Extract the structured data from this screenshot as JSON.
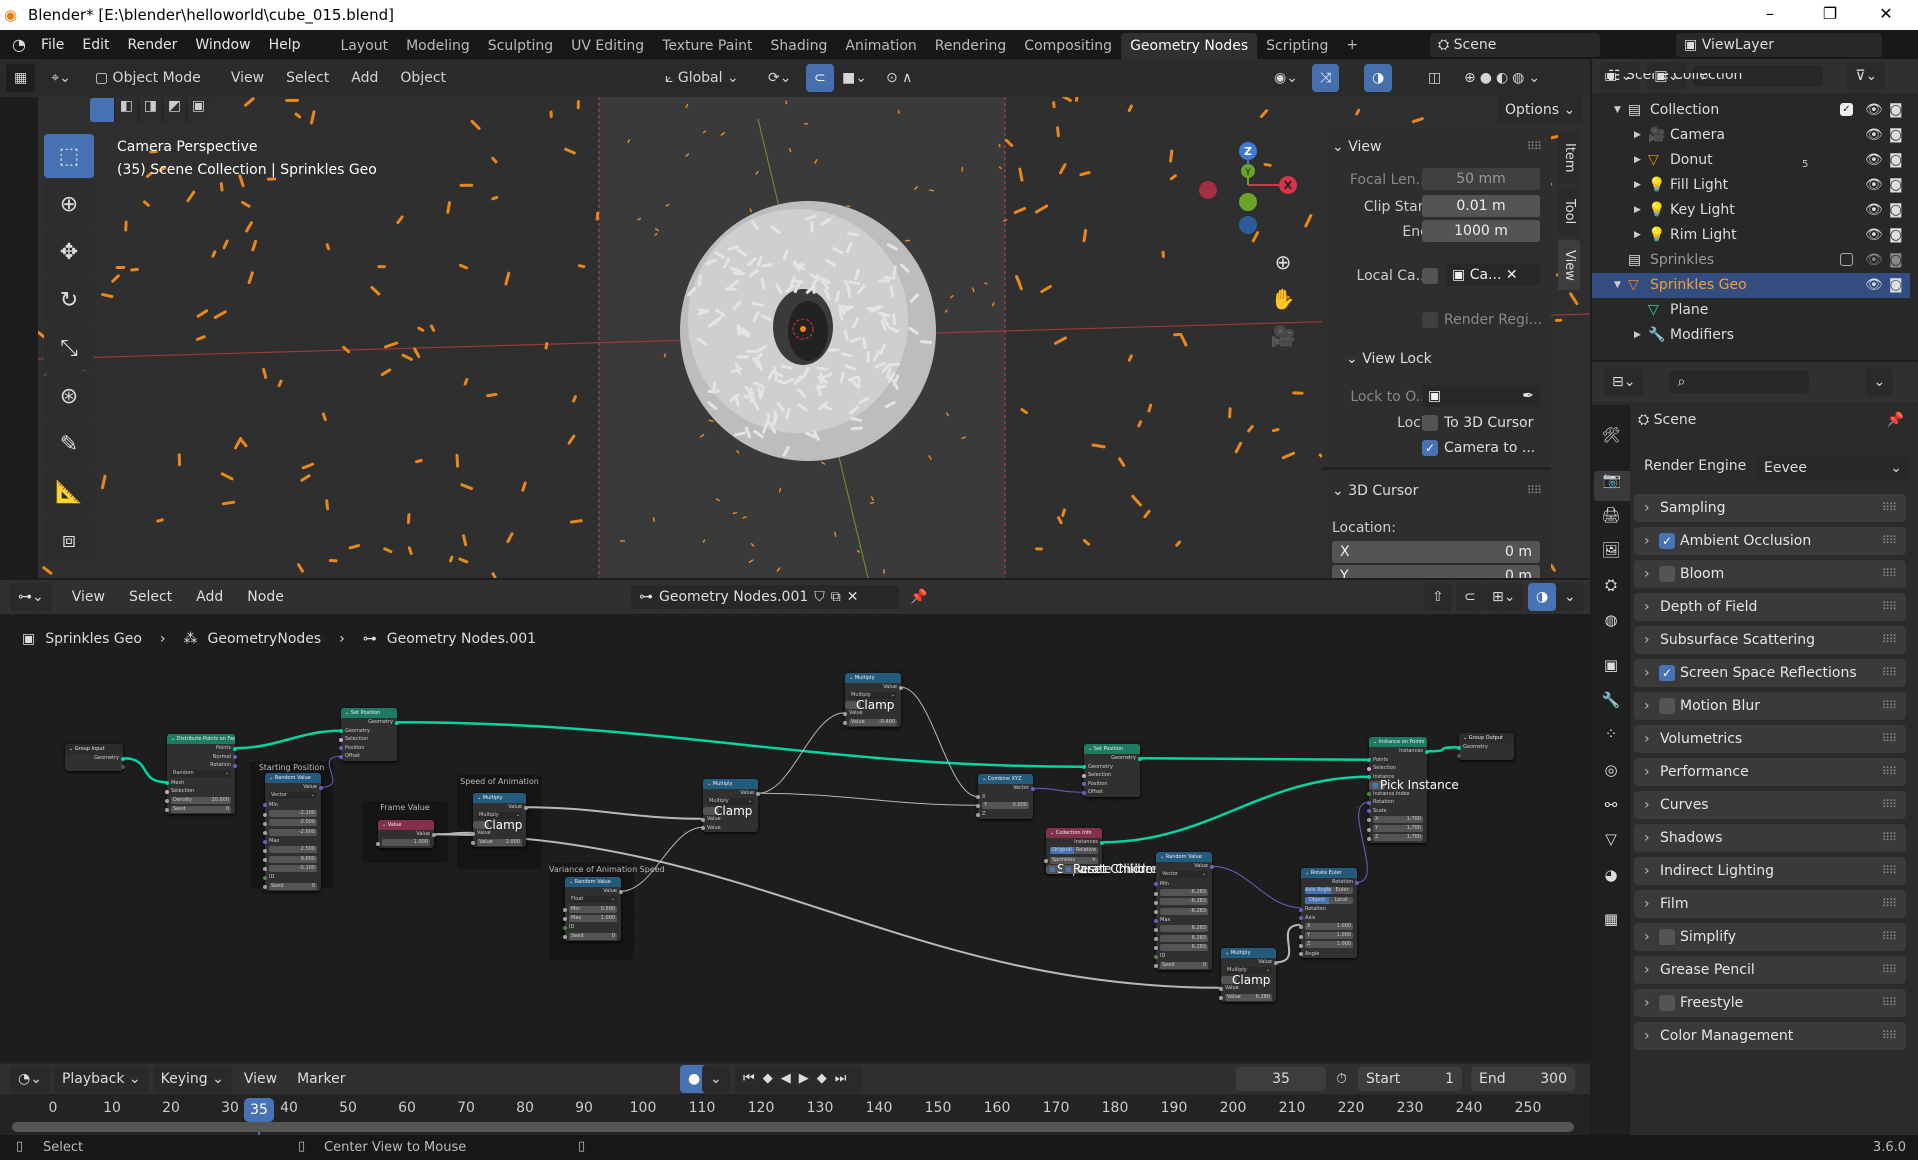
{
  "window": {
    "title": "Blender* [E:\\blender\\helloworld\\cube_015.blend]",
    "minimize": "–",
    "maximize": "❐",
    "close": "✕"
  },
  "menu": [
    "File",
    "Edit",
    "Render",
    "Window",
    "Help"
  ],
  "workspaces": [
    "Layout",
    "Modeling",
    "Sculpting",
    "UV Editing",
    "Texture Paint",
    "Shading",
    "Animation",
    "Rendering",
    "Compositing",
    "Geometry Nodes",
    "Scripting"
  ],
  "active_workspace": "Geometry Nodes",
  "add_workspace": "+",
  "scene": {
    "name": "Scene",
    "view_layer": "ViewLayer"
  },
  "viewport": {
    "mode": "Object Mode",
    "menus": [
      "View",
      "Select",
      "Add",
      "Object"
    ],
    "transform_orientation": "Global",
    "options": "Options",
    "info_title": "Camera Perspective",
    "info_sub": "(35) Scene Collection | Sprinkles Geo",
    "gizmo": {
      "z": "Z",
      "x": "X",
      "y": "Y"
    },
    "accent": "#4772b3",
    "sprinkle_color": "#e8871e"
  },
  "npanel": {
    "tabs": [
      "Item",
      "Tool",
      "View"
    ],
    "view": {
      "title": "View",
      "focal_label": "Focal Len...",
      "focal": "50 mm",
      "clip_start_label": "Clip Start",
      "clip_start": "0.01 m",
      "end_label": "End",
      "clip_end": "1000 m",
      "local_cam_label": "Local Ca...",
      "local_cam": "Ca...",
      "render_region": "Render Regi..."
    },
    "view_lock": {
      "title": "View Lock",
      "lock_obj_label": "Lock to O...",
      "lock_label": "Lock",
      "to_cursor": "To 3D Cursor",
      "camera_to": "Camera to ...",
      "camera_to_checked": true,
      "to_cursor_checked": false
    },
    "cursor": {
      "title": "3D Cursor",
      "location_label": "Location:",
      "x_label": "X",
      "x": "0 m",
      "y_label": "Y",
      "y": "0 m"
    }
  },
  "outliner": {
    "rows": [
      {
        "label": "Scene Collection",
        "icon": "scene-collection-icon"
      },
      {
        "label": "Collection",
        "icon": "collection-icon"
      },
      {
        "label": "Camera",
        "icon": "camera-icon"
      },
      {
        "label": "Donut",
        "icon": "mesh-icon",
        "extra": "5"
      },
      {
        "label": "Fill Light",
        "icon": "light-icon"
      },
      {
        "label": "Key Light",
        "icon": "light-icon"
      },
      {
        "label": "Rim Light",
        "icon": "light-icon"
      },
      {
        "label": "Sprinkles",
        "icon": "collection-icon"
      },
      {
        "label": "Sprinkles Geo",
        "icon": "mesh-icon"
      },
      {
        "label": "Plane",
        "icon": "mesh-data-icon"
      },
      {
        "label": "Modifiers",
        "icon": "wrench-icon"
      }
    ]
  },
  "properties": {
    "context": "Scene",
    "render_engine_label": "Render Engine",
    "render_engine": "Eevee",
    "sections": [
      {
        "label": "Sampling"
      },
      {
        "label": "Ambient Occlusion",
        "checkbox": true,
        "checked": true
      },
      {
        "label": "Bloom",
        "checkbox": true,
        "checked": false
      },
      {
        "label": "Depth of Field"
      },
      {
        "label": "Subsurface Scattering"
      },
      {
        "label": "Screen Space Reflections",
        "checkbox": true,
        "checked": true
      },
      {
        "label": "Motion Blur",
        "checkbox": true,
        "checked": false
      },
      {
        "label": "Volumetrics"
      },
      {
        "label": "Performance"
      },
      {
        "label": "Curves"
      },
      {
        "label": "Shadows"
      },
      {
        "label": "Indirect Lighting"
      },
      {
        "label": "Film"
      },
      {
        "label": "Simplify",
        "checkbox": true,
        "checked": false
      },
      {
        "label": "Grease Pencil"
      },
      {
        "label": "Freestyle",
        "checkbox": true,
        "checked": false
      },
      {
        "label": "Color Management"
      }
    ]
  },
  "node_editor": {
    "menus": [
      "View",
      "Select",
      "Add",
      "Node"
    ],
    "node_group": "Geometry Nodes.001",
    "breadcrumb": [
      "Sprinkles Geo",
      "GeometryNodes",
      "Geometry Nodes.001"
    ],
    "frames": {
      "starting": "Starting Position",
      "frame_value": "Frame Value",
      "speed": "Speed of Animation",
      "variance": "Variance of Animation Speed"
    },
    "colors": {
      "geometry": "#1e7a62",
      "vector": "#245a7c",
      "input": "#83314a",
      "group": "#2b2b2b",
      "geometry_wire": "#00d6a3"
    },
    "nodes": {
      "group_input": {
        "title": "Group Input",
        "kind": "group",
        "rows": [
          [
            "out",
            "Geometry",
            "g"
          ],
          [
            "out",
            "",
            "n"
          ]
        ]
      },
      "distribute": {
        "title": "Distribute Points on Faces",
        "kind": "geometry",
        "rows": [
          [
            "out",
            "Points",
            "g"
          ],
          [
            "out",
            "Normal",
            "v"
          ],
          [
            "out",
            "Rotation",
            "v"
          ],
          [
            "sel",
            "Random"
          ],
          [
            "in",
            "Mesh",
            "g"
          ],
          [
            "in",
            "Selection",
            "b"
          ],
          [
            "fld",
            "Density",
            "20.000"
          ],
          [
            "fld",
            "Seed",
            "0"
          ]
        ]
      },
      "random1": {
        "title": "Random Value",
        "kind": "vector",
        "rows": [
          [
            "out",
            "Value",
            "v"
          ],
          [
            "sel",
            "Vector"
          ],
          [
            "in",
            "Min",
            "v"
          ],
          [
            "fld",
            "",
            "-2.100"
          ],
          [
            "fld",
            "",
            "0.000"
          ],
          [
            "fld",
            "",
            "-2.000"
          ],
          [
            "in",
            "Max",
            "v"
          ],
          [
            "fld",
            "",
            "2.500"
          ],
          [
            "fld",
            "",
            "9.000"
          ],
          [
            "fld",
            "",
            "-0.100"
          ],
          [
            "in",
            "ID",
            "i"
          ],
          [
            "fld",
            "Seed",
            "0"
          ]
        ]
      },
      "setpos1": {
        "title": "Set Position",
        "kind": "geometry",
        "rows": [
          [
            "out",
            "Geometry",
            "g"
          ],
          [
            "in",
            "Geometry",
            "g"
          ],
          [
            "in",
            "Selection",
            "b"
          ],
          [
            "in",
            "Position",
            "v"
          ],
          [
            "in",
            "Offset",
            "v"
          ]
        ]
      },
      "value": {
        "title": "Value",
        "kind": "input",
        "rows": [
          [
            "out",
            "Value",
            "f"
          ],
          [
            "fld",
            "",
            "1.000"
          ]
        ]
      },
      "mult_speed": {
        "title": "Multiply",
        "kind": "vector",
        "rows": [
          [
            "out",
            "Value",
            "f"
          ],
          [
            "sel",
            "Multiply"
          ],
          [
            "chk",
            "Clamp"
          ],
          [
            "in",
            "Value",
            "f"
          ],
          [
            "fld",
            "Value",
            "2.000"
          ]
        ]
      },
      "random2": {
        "title": "Random Value",
        "kind": "vector",
        "rows": [
          [
            "out",
            "Value",
            "f"
          ],
          [
            "sel",
            "Float"
          ],
          [
            "fld",
            "Min",
            "0.500"
          ],
          [
            "fld",
            "Max",
            "1.000"
          ],
          [
            "in",
            "ID",
            "i"
          ],
          [
            "fld",
            "Seed",
            "0"
          ]
        ]
      },
      "mult2": {
        "title": "Multiply",
        "kind": "vector",
        "rows": [
          [
            "out",
            "Value",
            "f"
          ],
          [
            "sel",
            "Multiply"
          ],
          [
            "chk",
            "Clamp"
          ],
          [
            "in",
            "Value",
            "f"
          ],
          [
            "in",
            "Value",
            "f"
          ]
        ]
      },
      "mult3": {
        "title": "Multiply",
        "kind": "vector",
        "rows": [
          [
            "out",
            "Value",
            "f"
          ],
          [
            "sel",
            "Multiply"
          ],
          [
            "chk",
            "Clamp"
          ],
          [
            "in",
            "Value",
            "f"
          ],
          [
            "fld",
            "Value",
            "-0.400"
          ]
        ]
      },
      "combine": {
        "title": "Combine XYZ",
        "kind": "vector",
        "rows": [
          [
            "out",
            "Vector",
            "v"
          ],
          [
            "in",
            "X",
            "f"
          ],
          [
            "fld",
            "Y",
            "0.000"
          ],
          [
            "in",
            "Z",
            "f"
          ]
        ]
      },
      "setpos2": {
        "title": "Set Position",
        "kind": "geometry",
        "rows": [
          [
            "out",
            "Geometry",
            "g"
          ],
          [
            "in",
            "Geometry",
            "g"
          ],
          [
            "in",
            "Selection",
            "b"
          ],
          [
            "in",
            "Position",
            "v"
          ],
          [
            "in",
            "Offset",
            "v"
          ]
        ]
      },
      "collection": {
        "title": "Collection Info",
        "kind": "input",
        "rows": [
          [
            "out",
            "Instances",
            "g"
          ],
          [
            "tog",
            "Original",
            "Relative"
          ],
          [
            "fld",
            "Sprinkles",
            "✕"
          ],
          [
            "chk",
            "Separate Children"
          ],
          [
            "chk",
            "Reset Children"
          ]
        ]
      },
      "random3": {
        "title": "Random Value",
        "kind": "vector",
        "rows": [
          [
            "out",
            "Value",
            "v"
          ],
          [
            "sel",
            "Vector"
          ],
          [
            "in",
            "Min",
            "v"
          ],
          [
            "fld",
            "",
            "-6.283"
          ],
          [
            "fld",
            "",
            "-6.283"
          ],
          [
            "fld",
            "",
            "-6.283"
          ],
          [
            "in",
            "Max",
            "v"
          ],
          [
            "fld",
            "",
            "6.283"
          ],
          [
            "fld",
            "",
            "6.283"
          ],
          [
            "fld",
            "",
            "6.283"
          ],
          [
            "in",
            "ID",
            "i"
          ],
          [
            "fld",
            "Seed",
            "0"
          ]
        ]
      },
      "mult4": {
        "title": "Multiply",
        "kind": "vector",
        "rows": [
          [
            "out",
            "Value",
            "f"
          ],
          [
            "sel",
            "Multiply"
          ],
          [
            "chk",
            "Clamp"
          ],
          [
            "in",
            "Value",
            "f"
          ],
          [
            "fld",
            "Value",
            "6.280"
          ]
        ]
      },
      "rotate": {
        "title": "Rotate Euler",
        "kind": "vector",
        "rows": [
          [
            "out",
            "Rotation",
            "v"
          ],
          [
            "tog",
            "Axis Angle",
            "Euler"
          ],
          [
            "tog",
            "Object",
            "Local"
          ],
          [
            "in",
            "Rotation",
            "v"
          ],
          [
            "in",
            "Axis",
            "v"
          ],
          [
            "fld",
            "X",
            "1.000"
          ],
          [
            "fld",
            "Y",
            "1.000"
          ],
          [
            "fld",
            "Z",
            "1.000"
          ],
          [
            "in",
            "Angle",
            "f"
          ]
        ]
      },
      "instance": {
        "title": "Instance on Points",
        "kind": "geometry",
        "rows": [
          [
            "out",
            "Instances",
            "g"
          ],
          [
            "in",
            "Points",
            "g"
          ],
          [
            "in",
            "Selection",
            "b"
          ],
          [
            "in",
            "Instance",
            "g"
          ],
          [
            "chk",
            "Pick Instance"
          ],
          [
            "in",
            "Instance Index",
            "i"
          ],
          [
            "in",
            "Rotation",
            "v"
          ],
          [
            "in",
            "Scale",
            "v"
          ],
          [
            "fld",
            "X",
            "1.700"
          ],
          [
            "fld",
            "Y",
            "1.700"
          ],
          [
            "fld",
            "Z",
            "1.700"
          ]
        ]
      },
      "group_output": {
        "title": "Group Output",
        "kind": "group",
        "rows": [
          [
            "in",
            "Geometry",
            "g"
          ],
          [
            "in",
            "",
            "n"
          ]
        ]
      }
    }
  },
  "timeline": {
    "menus": [
      "Playback",
      "Keying",
      "View",
      "Marker"
    ],
    "current_frame": "35",
    "start_label": "Start",
    "start": "1",
    "end_label": "End",
    "end": "300",
    "ticks": [
      "0",
      "10",
      "20",
      "30",
      "40",
      "50",
      "60",
      "70",
      "80",
      "90",
      "100",
      "110",
      "120",
      "130",
      "140",
      "150",
      "160",
      "170",
      "180",
      "190",
      "200",
      "210",
      "220",
      "230",
      "240",
      "250"
    ]
  },
  "status": {
    "left": "Select",
    "middle": "Center View to Mouse",
    "version": "3.6.0"
  }
}
